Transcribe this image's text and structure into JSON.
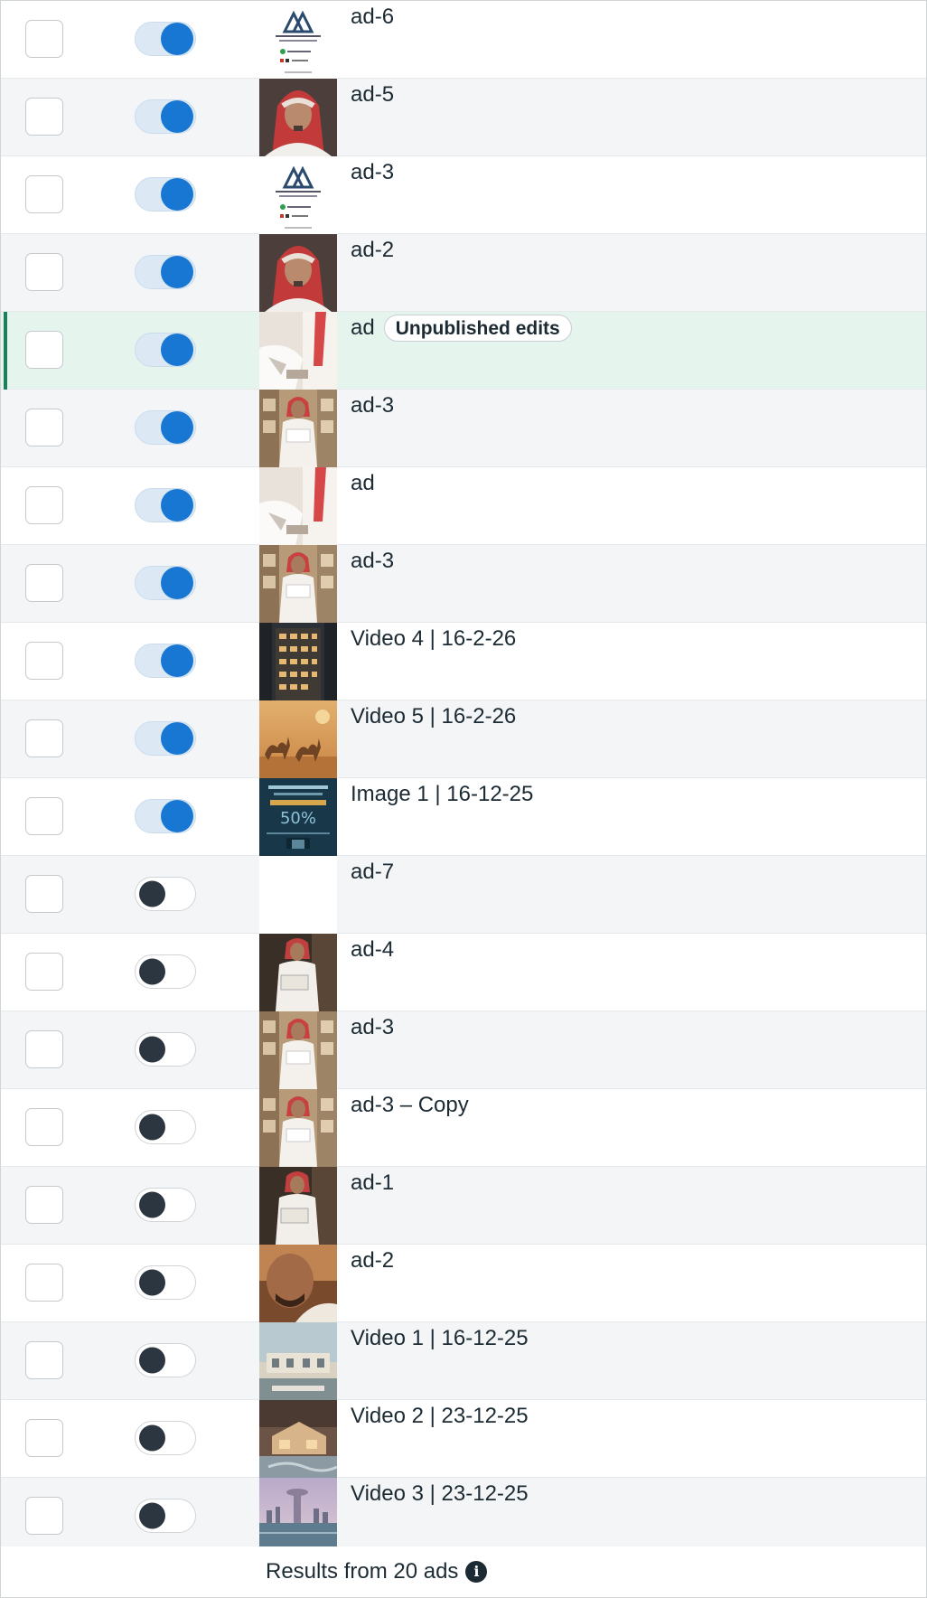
{
  "ads": [
    {
      "name": "ad-6",
      "active": true,
      "thumb": "logo-card",
      "badge": ""
    },
    {
      "name": "ad-5",
      "active": true,
      "thumb": "portrait-man",
      "badge": ""
    },
    {
      "name": "ad-3",
      "active": true,
      "thumb": "logo-card",
      "badge": ""
    },
    {
      "name": "ad-2",
      "active": true,
      "thumb": "portrait-man",
      "badge": ""
    },
    {
      "name": "ad",
      "active": true,
      "thumb": "white-thobe-closeup",
      "badge": "Unpublished edits"
    },
    {
      "name": "ad-3",
      "active": true,
      "thumb": "man-reading-interior",
      "badge": ""
    },
    {
      "name": "ad",
      "active": true,
      "thumb": "white-thobe-closeup",
      "badge": ""
    },
    {
      "name": "ad-3",
      "active": true,
      "thumb": "man-reading-interior",
      "badge": ""
    },
    {
      "name": "Video 4 | 16-2-26",
      "active": true,
      "thumb": "building-night",
      "badge": ""
    },
    {
      "name": "Video 5 | 16-2-26",
      "active": true,
      "thumb": "camels-desert",
      "badge": ""
    },
    {
      "name": "Image 1 | 16-12-25",
      "active": true,
      "thumb": "offer-poster",
      "badge": ""
    },
    {
      "name": "ad-7",
      "active": false,
      "thumb": "blank",
      "badge": ""
    },
    {
      "name": "ad-4",
      "active": false,
      "thumb": "man-reading-dark",
      "badge": ""
    },
    {
      "name": "ad-3",
      "active": false,
      "thumb": "man-reading-interior",
      "badge": ""
    },
    {
      "name": "ad-3 – Copy",
      "active": false,
      "thumb": "man-reading-interior",
      "badge": ""
    },
    {
      "name": "ad-1",
      "active": false,
      "thumb": "man-reading-dark",
      "badge": ""
    },
    {
      "name": "ad-2",
      "active": false,
      "thumb": "face-closeup",
      "badge": ""
    },
    {
      "name": "Video 1 | 16-12-25",
      "active": false,
      "thumb": "villa-exterior",
      "badge": ""
    },
    {
      "name": "Video 2 | 23-12-25",
      "active": false,
      "thumb": "house-model",
      "badge": ""
    },
    {
      "name": "Video 3 | 23-12-25",
      "active": false,
      "thumb": "city-skyline",
      "badge": ""
    }
  ],
  "selected_row": 4,
  "footer": {
    "results_text": "Results from 20 ads",
    "info_icon": "info-icon"
  },
  "colors": {
    "toggle_on": "#1877d2",
    "toggle_off_knob": "#2b3640",
    "selected_row_bg": "#e6f4ee",
    "selected_accent": "#1a7f5a",
    "alt_row_bg": "#f4f5f7"
  }
}
